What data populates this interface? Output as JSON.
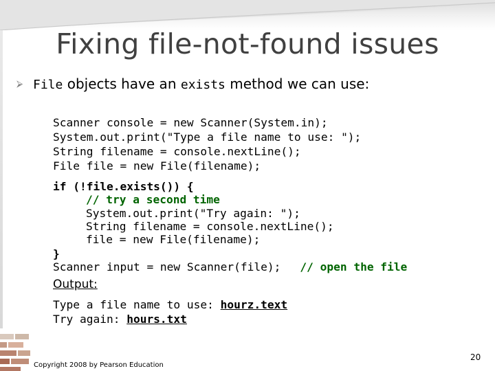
{
  "slide": {
    "title": "Fixing file-not-found issues",
    "bullet": {
      "code_word_1": "File",
      "text_1": "objects have an",
      "code_word_2": "exists",
      "text_2": "method we can use:"
    },
    "code_block_1": [
      "Scanner console = new Scanner(System.in);",
      "System.out.print(\"Type a file name to use: \");",
      "String filename = console.nextLine();",
      "File file = new File(filename);"
    ],
    "code_block_2": {
      "if_line": "if (!file.exists()) {",
      "comment_line": "// try a second time",
      "line_3": "System.out.print(\"Try again: \");",
      "line_4": "String filename = console.nextLine();",
      "line_5": "file = new File(filename);",
      "close_brace": "}",
      "last_code": "Scanner input = new Scanner(file);",
      "last_comment": "// open the file"
    },
    "output": {
      "label": "Output:",
      "line_1_prompt": "Type a file name to use: ",
      "line_1_input": "hourz.text",
      "line_2_prompt": "Try again: ",
      "line_2_input": "hours.txt"
    },
    "footer": {
      "copyright": "Copyright 2008 by Pearson Education",
      "page_number": "20"
    }
  }
}
